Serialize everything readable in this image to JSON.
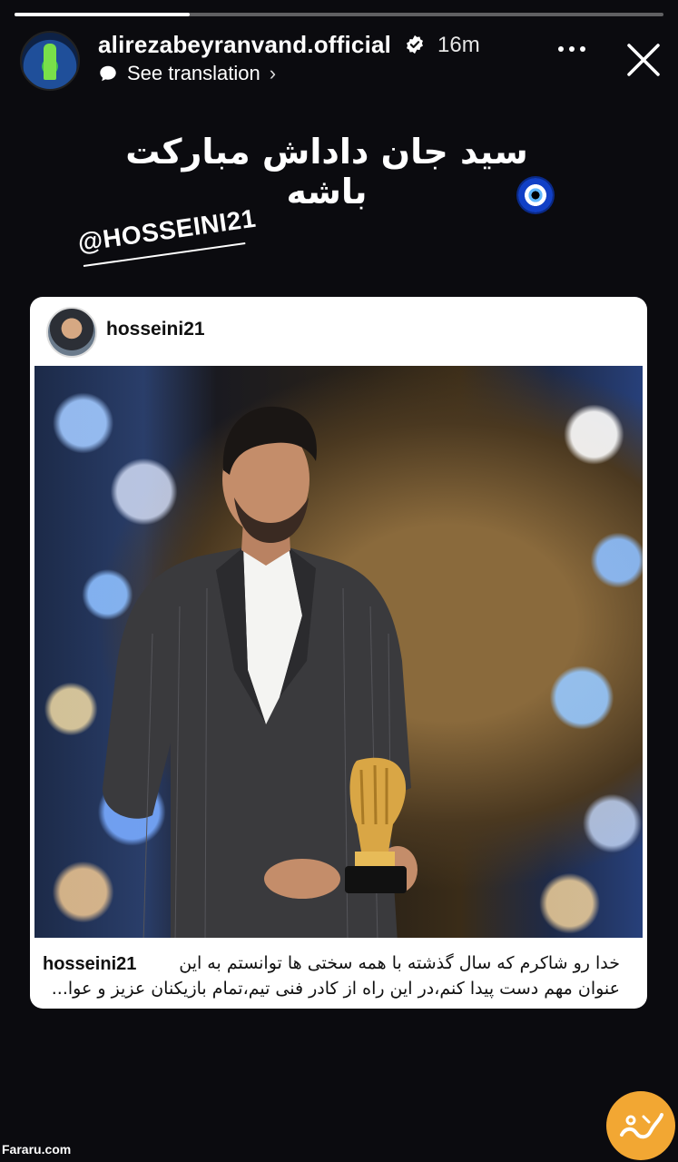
{
  "story": {
    "progress_fraction": 0.27,
    "account": "alirezabeyranvand.official",
    "verified": true,
    "time_ago": "16m",
    "see_translation": "See translation",
    "caption": "سید جان داداش مبارکت باشه",
    "mention": "@HOSSEINI21"
  },
  "shared_post": {
    "username": "hosseini21",
    "caption_user": "hosseini21",
    "caption_line1": "خدا رو شاکرم که سال گذشته با همه سختی ها توانستم به این",
    "caption_line2": "عنوان مهم دست پیدا کنم،در این راه از کادر فنی تیم،تمام بازیکنان عزیز و عوا..."
  },
  "watermark": {
    "site": "Fararu.com"
  },
  "icons": {
    "verified": "verified-badge-icon",
    "translate": "speech-bubble-icon",
    "more": "more-dots-icon",
    "close": "close-icon",
    "evil_eye": "nazar-amulet-emoji"
  },
  "colors": {
    "background": "#0b0b0f",
    "card": "#ffffff",
    "logo": "#f2a733"
  }
}
